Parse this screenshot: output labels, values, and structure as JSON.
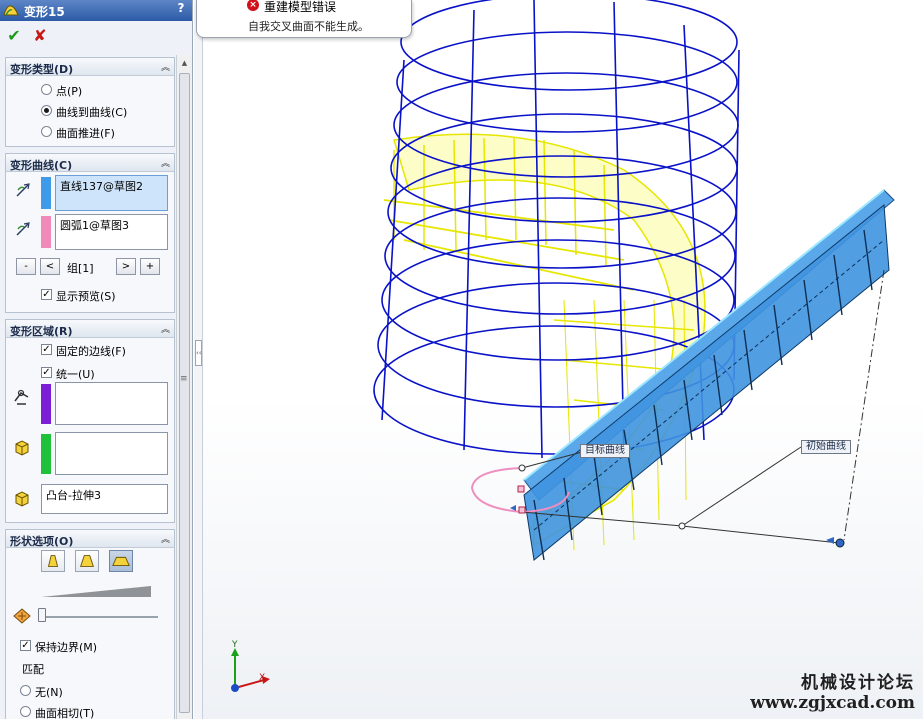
{
  "title": "变形15",
  "help_label": "?",
  "ok_label": "✔",
  "cancel_label": "✘",
  "deform_type": {
    "title": "变形类型(D)",
    "options": [
      {
        "label": "点(P)",
        "selected": false
      },
      {
        "label": "曲线到曲线(C)",
        "selected": true
      },
      {
        "label": "曲面推进(F)",
        "selected": false
      }
    ]
  },
  "deform_curves": {
    "title": "变形曲线(C)",
    "initial": "直线137@草图2",
    "target": "圆弧1@草图3",
    "group_label": "组[1]",
    "btn_minus": "-",
    "btn_prev": "<",
    "btn_next": ">",
    "btn_plus": "+",
    "show_preview": "显示预览(S)",
    "initial_color": "#3d9be9",
    "target_color": "#f08ab8"
  },
  "deform_region": {
    "title": "变形区域(R)",
    "fixed_edges": "固定的边线(F)",
    "uniform": "统一(U)",
    "body": "凸台-拉伸3",
    "fixed_color": "#7a1fd6",
    "extra_color": "#1ec23a"
  },
  "shape_options": {
    "title": "形状选项(O)",
    "keep_boundary": "保持边界(M)",
    "match_label": "匹配",
    "none_label": "无(N)",
    "tangent_label": "曲面相切(T)"
  },
  "error": {
    "title": "重建模型错误",
    "message": "自我交叉曲面不能生成。"
  },
  "callouts": {
    "target_curve": "目标曲线",
    "initial_curve": "初始曲线"
  },
  "triad": {
    "x": "X",
    "y": "Y"
  },
  "watermark": {
    "line1": "机械设计论坛",
    "line2": "www.zgjxcad.com"
  }
}
